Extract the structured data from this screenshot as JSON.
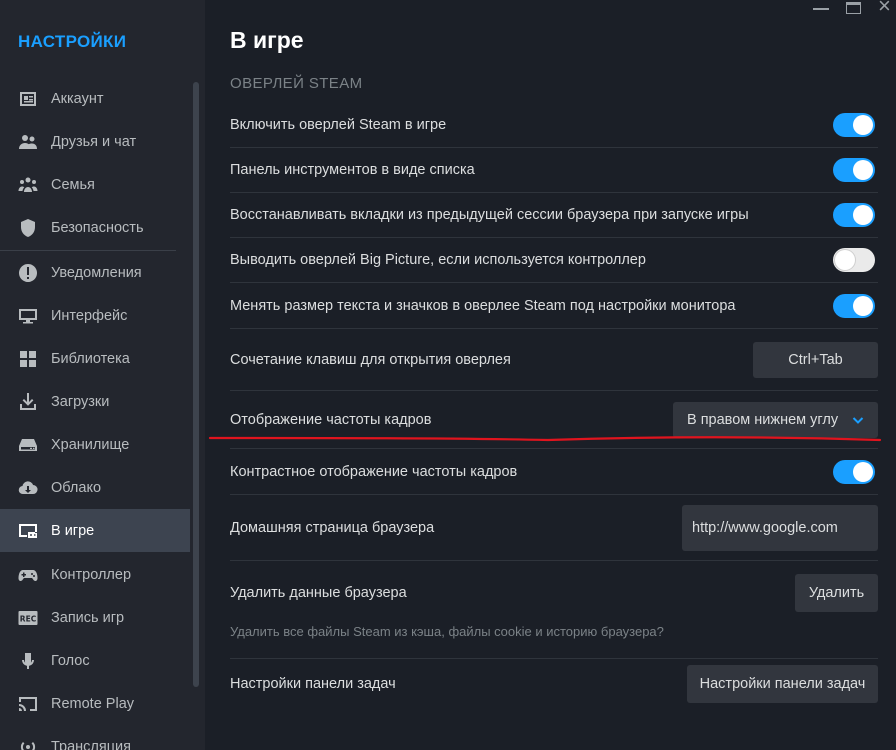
{
  "sidebar": {
    "title": "НАСТРОЙКИ",
    "items": [
      {
        "label": "Аккаунт",
        "icon": "account-card-icon"
      },
      {
        "label": "Друзья и чат",
        "icon": "friends-icon"
      },
      {
        "label": "Семья",
        "icon": "family-icon"
      },
      {
        "label": "Безопасность",
        "icon": "shield-icon"
      },
      {
        "label": "Уведомления",
        "icon": "notification-icon"
      },
      {
        "label": "Интерфейс",
        "icon": "monitor-icon"
      },
      {
        "label": "Библиотека",
        "icon": "library-grid-icon"
      },
      {
        "label": "Загрузки",
        "icon": "download-icon"
      },
      {
        "label": "Хранилище",
        "icon": "storage-icon"
      },
      {
        "label": "Облако",
        "icon": "cloud-icon"
      },
      {
        "label": "В игре",
        "icon": "in-game-icon",
        "active": true
      },
      {
        "label": "Контроллер",
        "icon": "controller-icon"
      },
      {
        "label": "Запись игр",
        "icon": "rec-icon"
      },
      {
        "label": "Голос",
        "icon": "microphone-icon"
      },
      {
        "label": "Remote Play",
        "icon": "remote-play-icon"
      },
      {
        "label": "Трансляция",
        "icon": "broadcast-icon"
      }
    ]
  },
  "main": {
    "title": "В игре",
    "section": "ОВЕРЛЕЙ STEAM",
    "rows": {
      "overlay_enable": {
        "label": "Включить оверлей Steam в игре",
        "on": true
      },
      "toolbar_list": {
        "label": "Панель инструментов в виде списка",
        "on": true
      },
      "restore_tabs": {
        "label": "Восстанавливать вкладки из предыдущей сессии браузера при запуске игры",
        "on": true
      },
      "big_picture": {
        "label": "Выводить оверлей Big Picture, если используется контроллер",
        "on": false
      },
      "resize_text": {
        "label": "Менять размер текста и значков в оверлее Steam под настройки монитора",
        "on": true
      },
      "shortcut": {
        "label": "Сочетание клавиш для открытия оверлея",
        "value": "Ctrl+Tab"
      },
      "fps": {
        "label": "Отображение частоты кадров",
        "value": "В правом нижнем углу"
      },
      "fps_contrast": {
        "label": "Контрастное отображение частоты кадров",
        "on": true
      },
      "homepage": {
        "label": "Домашняя страница браузера",
        "value": "http://www.google.com"
      },
      "delete_browser": {
        "label": "Удалить данные браузера",
        "button": "Удалить",
        "description": "Удалить все файлы Steam из кэша, файлы cookie и историю браузера?"
      },
      "taskbar": {
        "label": "Настройки панели задач",
        "button": "Настройки панели задач"
      }
    }
  },
  "colors": {
    "accent": "#1a9fff",
    "annotation": "#e0141e"
  }
}
